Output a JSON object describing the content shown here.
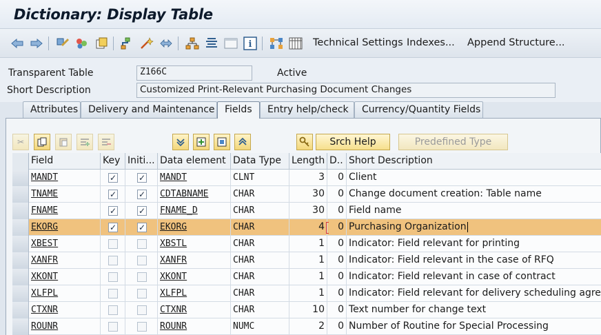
{
  "window": {
    "title": "Dictionary: Display Table"
  },
  "toolbar": {
    "icons": [
      "back-arrow-icon",
      "forward-arrow-icon",
      "other-object-icon",
      "display-change-icon",
      "activate-icon",
      "check-icon",
      "where-used-icon",
      "object-list-icon",
      "hierarchy-icon",
      "navigation-icon",
      "window-icon",
      "info-icon",
      "graphic-icon",
      "table-icon"
    ],
    "technical_settings": "Technical Settings",
    "indexes": "Indexes...",
    "append_structure": "Append Structure..."
  },
  "header": {
    "table_type_label": "Transparent Table",
    "table_name": "Z166C",
    "status": "Active",
    "short_desc_label": "Short Description",
    "short_desc": "Customized Print-Relevant Purchasing Document Changes"
  },
  "tabs": [
    {
      "label": "Attributes"
    },
    {
      "label": "Delivery and Maintenance"
    },
    {
      "label": "Fields"
    },
    {
      "label": "Entry help/check"
    },
    {
      "label": "Currency/Quantity Fields"
    }
  ],
  "panel_toolbar": {
    "srch_help": "Srch Help",
    "predefined_type": "Predefined Type"
  },
  "columns": {
    "field": "Field",
    "key": "Key",
    "initial": "Initi...",
    "data_element": "Data element",
    "data_type": "Data Type",
    "length": "Length",
    "decimals": "D..",
    "short_description": "Short Description"
  },
  "rows": [
    {
      "field": "MANDT",
      "key": true,
      "initial": true,
      "data_element": "MANDT",
      "data_type": "CLNT",
      "length": "3",
      "decimals": "0",
      "desc": "Client"
    },
    {
      "field": "TNAME",
      "key": true,
      "initial": true,
      "data_element": "CDTABNAME",
      "data_type": "CHAR",
      "length": "30",
      "decimals": "0",
      "desc": "Change document creation: Table name"
    },
    {
      "field": "FNAME",
      "key": true,
      "initial": true,
      "data_element": "FNAME_D",
      "data_type": "CHAR",
      "length": "30",
      "decimals": "0",
      "desc": "Field name"
    },
    {
      "field": "EKORG",
      "key": true,
      "initial": true,
      "data_element": "EKORG",
      "data_type": "CHAR",
      "length": "4",
      "decimals": "0",
      "desc": "Purchasing Organization"
    },
    {
      "field": "XBEST",
      "key": false,
      "initial": false,
      "data_element": "XBSTL",
      "data_type": "CHAR",
      "length": "1",
      "decimals": "0",
      "desc": "Indicator: Field relevant for printing"
    },
    {
      "field": "XANFR",
      "key": false,
      "initial": false,
      "data_element": "XANFR",
      "data_type": "CHAR",
      "length": "1",
      "decimals": "0",
      "desc": "Indicator: Field relevant in the case of RFQ"
    },
    {
      "field": "XKONT",
      "key": false,
      "initial": false,
      "data_element": "XKONT",
      "data_type": "CHAR",
      "length": "1",
      "decimals": "0",
      "desc": "Indicator: Field relevant in case of contract"
    },
    {
      "field": "XLFPL",
      "key": false,
      "initial": false,
      "data_element": "XLFPL",
      "data_type": "CHAR",
      "length": "1",
      "decimals": "0",
      "desc": "Indicator: Field relevant for delivery scheduling agreement"
    },
    {
      "field": "CTXNR",
      "key": false,
      "initial": false,
      "data_element": "CTXNR",
      "data_type": "CHAR",
      "length": "10",
      "decimals": "0",
      "desc": "Text number for change text"
    },
    {
      "field": "ROUNR",
      "key": false,
      "initial": false,
      "data_element": "ROUNR",
      "data_type": "NUMC",
      "length": "2",
      "decimals": "0",
      "desc": "Number of Routine for Special Processing"
    }
  ],
  "selected_row": 3,
  "check_glyph": "✓",
  "colors": {
    "selected_row": "#f0c27e",
    "accent": "#2a5c93"
  }
}
